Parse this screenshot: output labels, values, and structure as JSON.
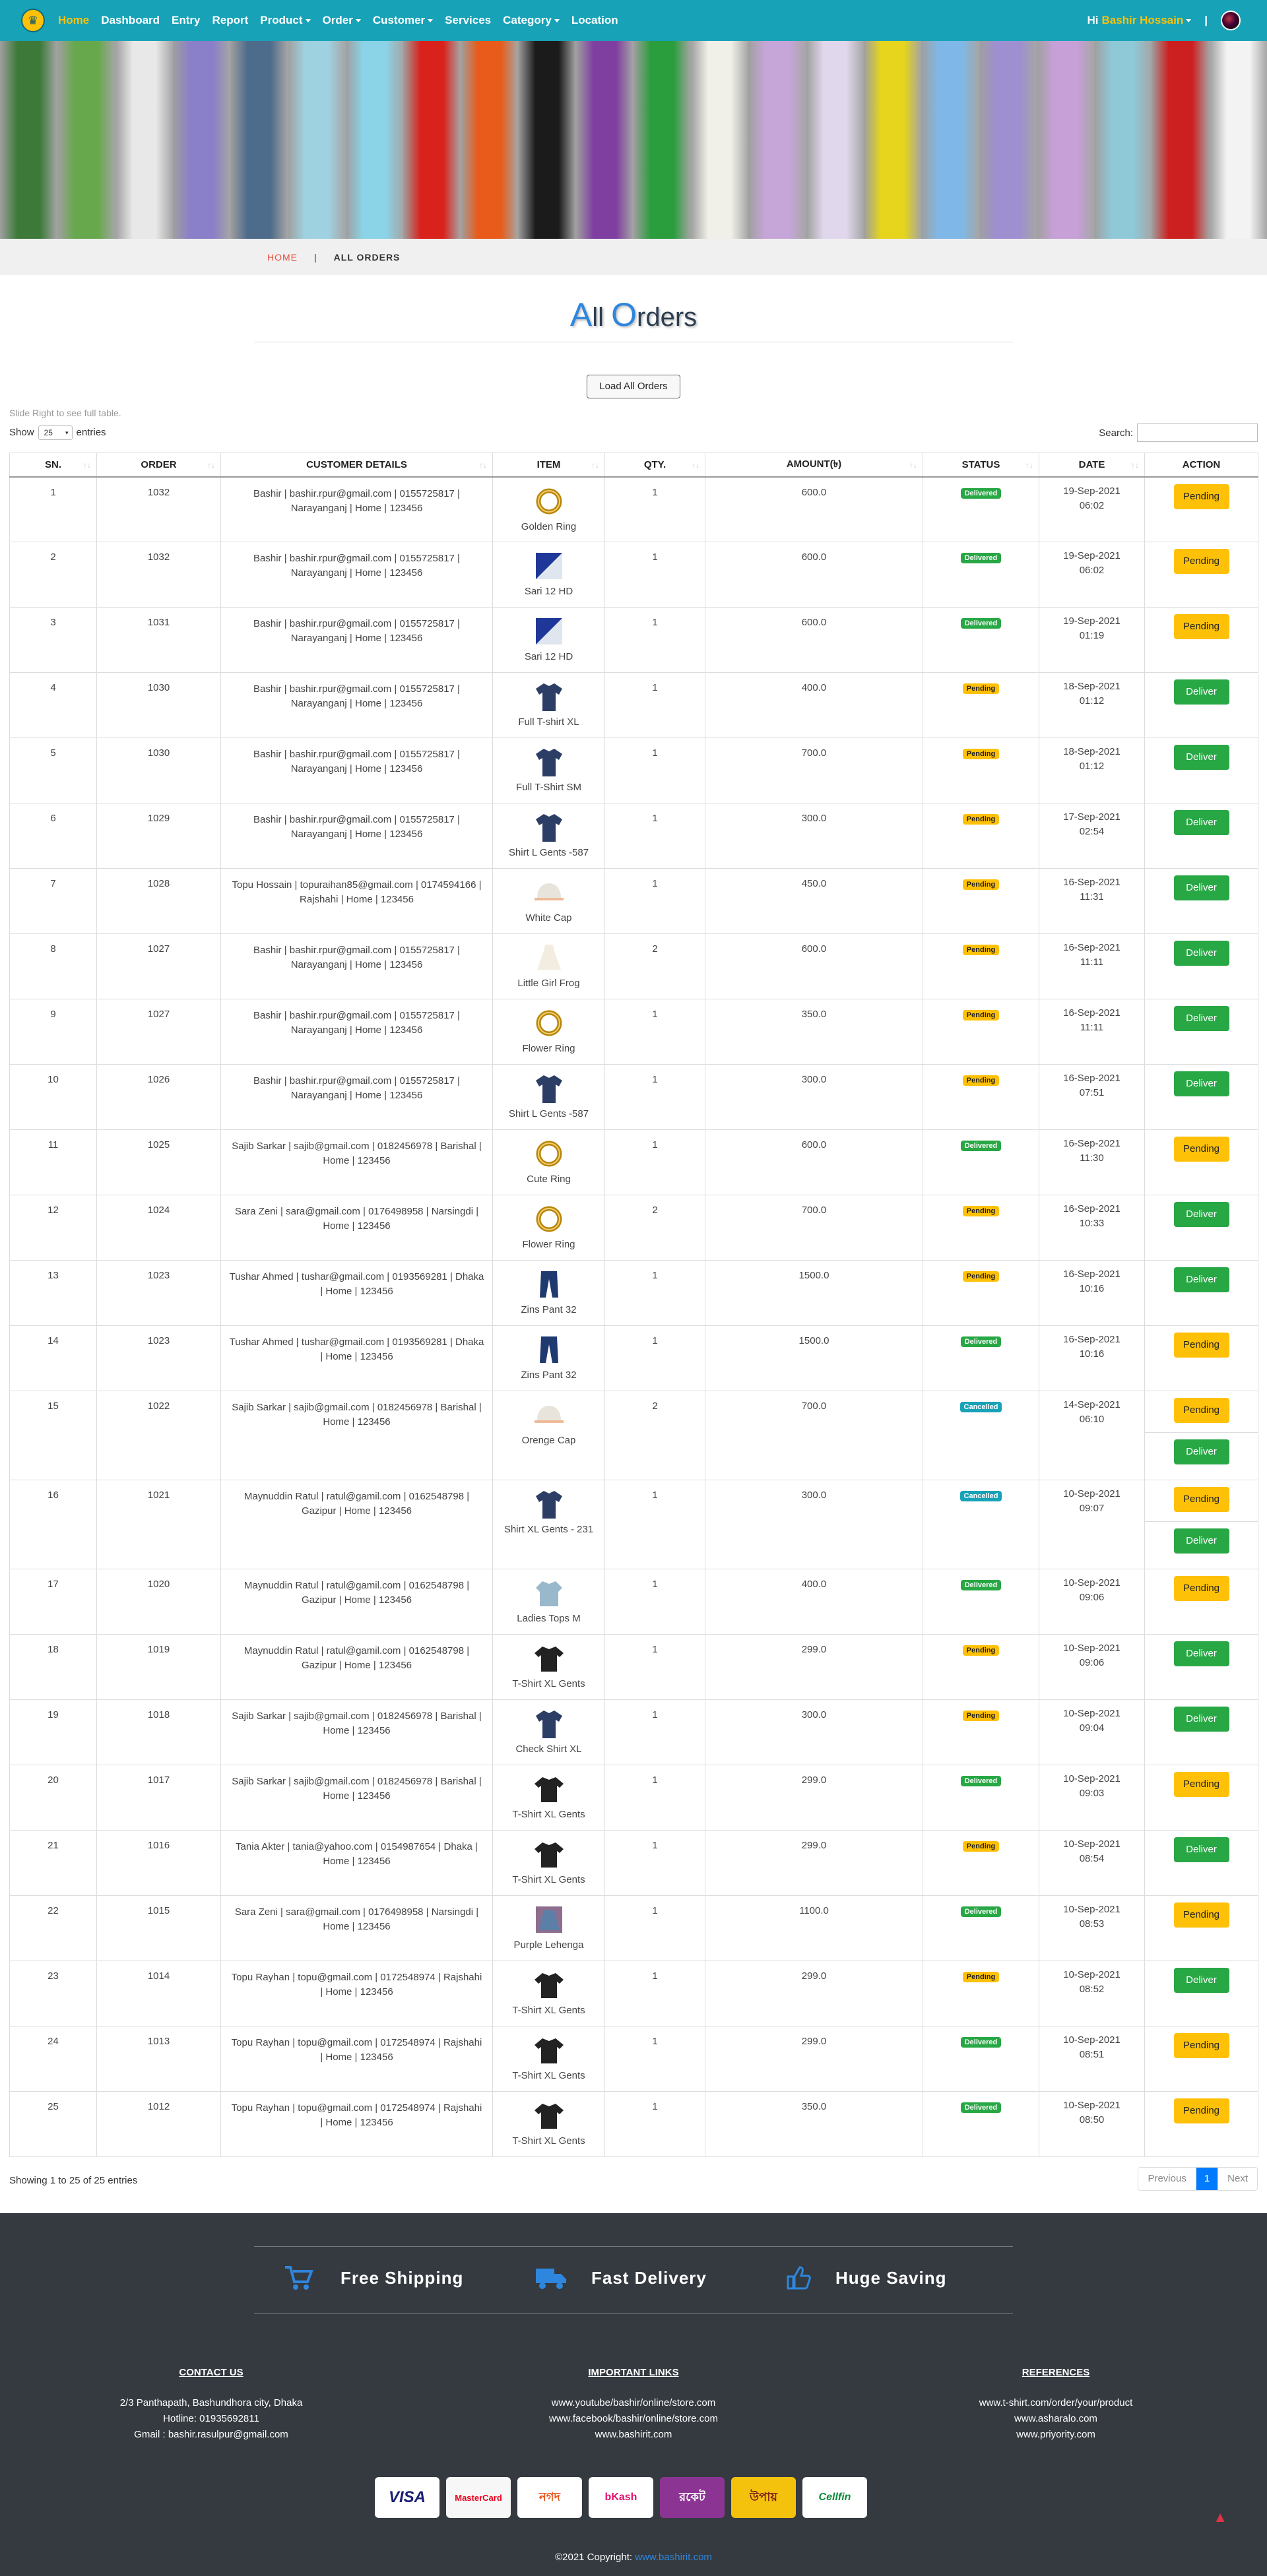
{
  "nav": {
    "items": [
      "Home",
      "Dashboard",
      "Entry",
      "Report",
      "Product",
      "Order",
      "Customer",
      "Services",
      "Category",
      "Location"
    ],
    "dropdowns": [
      false,
      false,
      false,
      false,
      true,
      true,
      true,
      false,
      true,
      false
    ],
    "greeting": "Hi",
    "user": "Bashir Hossain",
    "separator": "|"
  },
  "breadcrumb": {
    "home": "HOME",
    "sep": "|",
    "current": "ALL ORDERS"
  },
  "page": {
    "title_first": "A",
    "title_mid": "ll ",
    "title_o": "O",
    "title_rest": "rders"
  },
  "controls": {
    "load_all": "Load All Orders",
    "slide_note": "Slide Right to see full table.",
    "show": "Show",
    "length": "25",
    "entries": "entries",
    "search": "Search:"
  },
  "columns": [
    "SN.",
    "ORDER",
    "CUSTOMER DETAILS",
    "ITEM",
    "QTY.",
    "AMOUNT(৳)",
    "STATUS",
    "DATE",
    "ACTION"
  ],
  "rows": [
    {
      "sn": "1",
      "order": "1032",
      "customer": "Bashir | bashir.rpur@gmail.com | 0155725817 | Narayanganj | Home | 123456",
      "item": "Golden Ring",
      "icon": "ring-icon",
      "qty": "1",
      "amount": "600.0",
      "status": "Delivered",
      "date": "19-Sep-2021",
      "time": "06:02",
      "actions": [
        "Pending"
      ]
    },
    {
      "sn": "2",
      "order": "1032",
      "customer": "Bashir | bashir.rpur@gmail.com | 0155725817 | Narayanganj | Home | 123456",
      "item": "Sari 12 HD",
      "icon": "sari-icon",
      "qty": "1",
      "amount": "600.0",
      "status": "Delivered",
      "date": "19-Sep-2021",
      "time": "06:02",
      "actions": [
        "Pending"
      ]
    },
    {
      "sn": "3",
      "order": "1031",
      "customer": "Bashir | bashir.rpur@gmail.com | 0155725817 | Narayanganj | Home | 123456",
      "item": "Sari 12 HD",
      "icon": "sari-icon",
      "qty": "1",
      "amount": "600.0",
      "status": "Delivered",
      "date": "19-Sep-2021",
      "time": "01:19",
      "actions": [
        "Pending"
      ]
    },
    {
      "sn": "4",
      "order": "1030",
      "customer": "Bashir | bashir.rpur@gmail.com | 0155725817 | Narayanganj | Home | 123456",
      "item": "Full T-shirt XL",
      "icon": "shirt-icon",
      "qty": "1",
      "amount": "400.0",
      "status": "Pending",
      "date": "18-Sep-2021",
      "time": "01:12",
      "actions": [
        "Deliver"
      ]
    },
    {
      "sn": "5",
      "order": "1030",
      "customer": "Bashir | bashir.rpur@gmail.com | 0155725817 | Narayanganj | Home | 123456",
      "item": "Full T-Shirt SM",
      "icon": "shirt-icon",
      "qty": "1",
      "amount": "700.0",
      "status": "Pending",
      "date": "18-Sep-2021",
      "time": "01:12",
      "actions": [
        "Deliver"
      ]
    },
    {
      "sn": "6",
      "order": "1029",
      "customer": "Bashir | bashir.rpur@gmail.com | 0155725817 | Narayanganj | Home | 123456",
      "item": "Shirt L Gents -587",
      "icon": "shirt-icon",
      "qty": "1",
      "amount": "300.0",
      "status": "Pending",
      "date": "17-Sep-2021",
      "time": "02:54",
      "actions": [
        "Deliver"
      ]
    },
    {
      "sn": "7",
      "order": "1028",
      "customer": "Topu Hossain | topuraihan85@gmail.com | 0174594166 | Rajshahi | Home | 123456",
      "item": "White Cap",
      "icon": "cap-icon",
      "qty": "1",
      "amount": "450.0",
      "status": "Pending",
      "date": "16-Sep-2021",
      "time": "11:31",
      "actions": [
        "Deliver"
      ]
    },
    {
      "sn": "8",
      "order": "1027",
      "customer": "Bashir | bashir.rpur@gmail.com | 0155725817 | Narayanganj | Home | 123456",
      "item": "Little Girl Frog",
      "icon": "frock-icon",
      "qty": "2",
      "amount": "600.0",
      "status": "Pending",
      "date": "16-Sep-2021",
      "time": "11:11",
      "actions": [
        "Deliver"
      ]
    },
    {
      "sn": "9",
      "order": "1027",
      "customer": "Bashir | bashir.rpur@gmail.com | 0155725817 | Narayanganj | Home | 123456",
      "item": "Flower Ring",
      "icon": "ring-icon",
      "qty": "1",
      "amount": "350.0",
      "status": "Pending",
      "date": "16-Sep-2021",
      "time": "11:11",
      "actions": [
        "Deliver"
      ]
    },
    {
      "sn": "10",
      "order": "1026",
      "customer": "Bashir | bashir.rpur@gmail.com | 0155725817 | Narayanganj | Home | 123456",
      "item": "Shirt L Gents -587",
      "icon": "shirt-icon",
      "qty": "1",
      "amount": "300.0",
      "status": "Pending",
      "date": "16-Sep-2021",
      "time": "07:51",
      "actions": [
        "Deliver"
      ]
    },
    {
      "sn": "11",
      "order": "1025",
      "customer": "Sajib Sarkar | sajib@gmail.com | 0182456978 | Barishal | Home | 123456",
      "item": "Cute Ring",
      "icon": "ring-icon",
      "qty": "1",
      "amount": "600.0",
      "status": "Delivered",
      "date": "16-Sep-2021",
      "time": "11:30",
      "actions": [
        "Pending"
      ]
    },
    {
      "sn": "12",
      "order": "1024",
      "customer": "Sara Zeni | sara@gmail.com | 0176498958 | Narsingdi | Home | 123456",
      "item": "Flower Ring",
      "icon": "ring-icon",
      "qty": "2",
      "amount": "700.0",
      "status": "Pending",
      "date": "16-Sep-2021",
      "time": "10:33",
      "actions": [
        "Deliver"
      ]
    },
    {
      "sn": "13",
      "order": "1023",
      "customer": "Tushar Ahmed | tushar@gmail.com | 0193569281 | Dhaka | Home | 123456",
      "item": "Zins Pant 32",
      "icon": "pant-icon",
      "qty": "1",
      "amount": "1500.0",
      "status": "Pending",
      "date": "16-Sep-2021",
      "time": "10:16",
      "actions": [
        "Deliver"
      ]
    },
    {
      "sn": "14",
      "order": "1023",
      "customer": "Tushar Ahmed | tushar@gmail.com | 0193569281 | Dhaka | Home | 123456",
      "item": "Zins Pant 32",
      "icon": "pant-icon",
      "qty": "1",
      "amount": "1500.0",
      "status": "Delivered",
      "date": "16-Sep-2021",
      "time": "10:16",
      "actions": [
        "Pending"
      ]
    },
    {
      "sn": "15",
      "order": "1022",
      "customer": "Sajib Sarkar | sajib@gmail.com | 0182456978 | Barishal | Home | 123456",
      "item": "Orenge Cap",
      "icon": "cap-icon",
      "qty": "2",
      "amount": "700.0",
      "status": "Cancelled",
      "date": "14-Sep-2021",
      "time": "06:10",
      "actions": [
        "Pending",
        "Deliver"
      ]
    },
    {
      "sn": "16",
      "order": "1021",
      "customer": "Maynuddin Ratul | ratul@gamil.com | 0162548798 | Gazipur | Home | 123456",
      "item": "Shirt XL Gents - 231",
      "icon": "shirt-icon",
      "qty": "1",
      "amount": "300.0",
      "status": "Cancelled",
      "date": "10-Sep-2021",
      "time": "09:07",
      "actions": [
        "Pending",
        "Deliver"
      ]
    },
    {
      "sn": "17",
      "order": "1020",
      "customer": "Maynuddin Ratul | ratul@gamil.com | 0162548798 | Gazipur | Home | 123456",
      "item": "Ladies Tops M",
      "icon": "tops-icon",
      "qty": "1",
      "amount": "400.0",
      "status": "Delivered",
      "date": "10-Sep-2021",
      "time": "09:06",
      "actions": [
        "Pending"
      ]
    },
    {
      "sn": "18",
      "order": "1019",
      "customer": "Maynuddin Ratul | ratul@gamil.com | 0162548798 | Gazipur | Home | 123456",
      "item": "T-Shirt XL Gents",
      "icon": "tshirt-icon",
      "qty": "1",
      "amount": "299.0",
      "status": "Pending",
      "date": "10-Sep-2021",
      "time": "09:06",
      "actions": [
        "Deliver"
      ]
    },
    {
      "sn": "19",
      "order": "1018",
      "customer": "Sajib Sarkar | sajib@gmail.com | 0182456978 | Barishal | Home | 123456",
      "item": "Check Shirt XL",
      "icon": "shirt-icon",
      "qty": "1",
      "amount": "300.0",
      "status": "Pending",
      "date": "10-Sep-2021",
      "time": "09:04",
      "actions": [
        "Deliver"
      ]
    },
    {
      "sn": "20",
      "order": "1017",
      "customer": "Sajib Sarkar | sajib@gmail.com | 0182456978 | Barishal | Home | 123456",
      "item": "T-Shirt XL Gents",
      "icon": "tshirt-icon",
      "qty": "1",
      "amount": "299.0",
      "status": "Delivered",
      "date": "10-Sep-2021",
      "time": "09:03",
      "actions": [
        "Pending"
      ]
    },
    {
      "sn": "21",
      "order": "1016",
      "customer": "Tania Akter | tania@yahoo.com | 0154987654 | Dhaka | Home | 123456",
      "item": "T-Shirt XL Gents",
      "icon": "tshirt-icon",
      "qty": "1",
      "amount": "299.0",
      "status": "Pending",
      "date": "10-Sep-2021",
      "time": "08:54",
      "actions": [
        "Deliver"
      ]
    },
    {
      "sn": "22",
      "order": "1015",
      "customer": "Sara Zeni | sara@gmail.com | 0176498958 | Narsingdi | Home | 123456",
      "item": "Purple Lehenga",
      "icon": "lehenga-icon",
      "qty": "1",
      "amount": "1100.0",
      "status": "Delivered",
      "date": "10-Sep-2021",
      "time": "08:53",
      "actions": [
        "Pending"
      ]
    },
    {
      "sn": "23",
      "order": "1014",
      "customer": "Topu Rayhan | topu@gmail.com | 0172548974 | Rajshahi | Home | 123456",
      "item": "T-Shirt XL Gents",
      "icon": "tshirt-icon",
      "qty": "1",
      "amount": "299.0",
      "status": "Pending",
      "date": "10-Sep-2021",
      "time": "08:52",
      "actions": [
        "Deliver"
      ]
    },
    {
      "sn": "24",
      "order": "1013",
      "customer": "Topu Rayhan | topu@gmail.com | 0172548974 | Rajshahi | Home | 123456",
      "item": "T-Shirt XL Gents",
      "icon": "tshirt-icon",
      "qty": "1",
      "amount": "299.0",
      "status": "Delivered",
      "date": "10-Sep-2021",
      "time": "08:51",
      "actions": [
        "Pending"
      ]
    },
    {
      "sn": "25",
      "order": "1012",
      "customer": "Topu Rayhan | topu@gmail.com | 0172548974 | Rajshahi | Home | 123456",
      "item": "T-Shirt XL Gents",
      "icon": "tshirt-icon",
      "qty": "1",
      "amount": "350.0",
      "status": "Delivered",
      "date": "10-Sep-2021",
      "time": "08:50",
      "actions": [
        "Pending"
      ]
    }
  ],
  "table_footer": {
    "info": "Showing 1 to 25 of 25 entries",
    "previous": "Previous",
    "page": "1",
    "next": "Next"
  },
  "features": [
    {
      "label": "Free Shipping",
      "icon": "cart-icon"
    },
    {
      "label": "Fast Delivery",
      "icon": "truck-icon"
    },
    {
      "label": "Huge Saving",
      "icon": "thumbs-up-icon"
    }
  ],
  "footer": {
    "contact": {
      "heading": "CONTACT US",
      "lines": [
        "2/3 Panthapath, Bashundhora city, Dhaka",
        "Hotline: 01935692811",
        "Gmail : bashir.rasulpur@gmail.com"
      ]
    },
    "links": {
      "heading": "IMPORTANT LINKS",
      "lines": [
        "www.youtube/bashir/online/store.com",
        "www.facebook/bashir/online/store.com",
        "www.bashirit.com"
      ]
    },
    "refs": {
      "heading": "REFERENCES",
      "lines": [
        "www.t-shirt.com/order/your/product",
        "www.asharalo.com",
        "www.priyority.com"
      ]
    },
    "payments": [
      "VISA",
      "MasterCard",
      "নগদ",
      "bKash",
      "রকেট",
      "উপায়",
      "Cellfin"
    ],
    "copyright": "©2021 Copyright:",
    "copyright_link": "www.bashirit.com"
  },
  "colors": {
    "nav": "#17a2b8",
    "accent": "#ffc107",
    "delivered": "#28a745",
    "cancelled": "#17a2b8",
    "footer": "#343a40"
  }
}
